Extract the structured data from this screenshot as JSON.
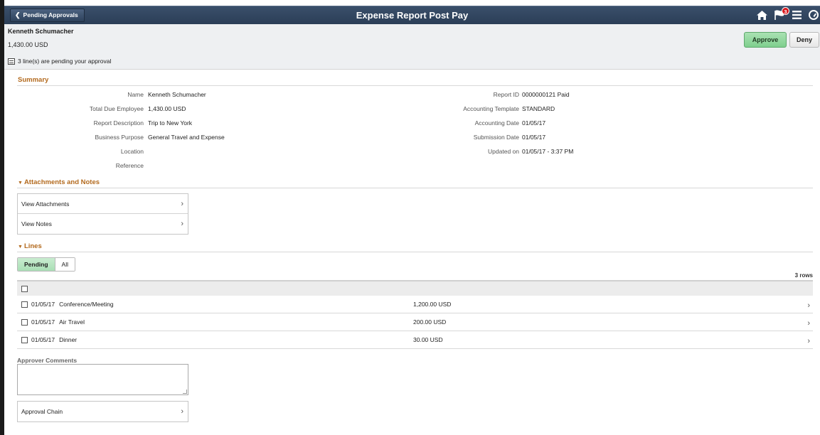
{
  "banner": {
    "back_label": "Pending Approvals",
    "title": "Expense Report Post Pay",
    "notification_count": "3",
    "icons": [
      "home-icon",
      "flag-icon",
      "menu-icon",
      "navbar-icon"
    ]
  },
  "header": {
    "employee_name": "Kenneth Schumacher",
    "amount": "1,430.00  USD",
    "pending_lines": "3 line(s) are pending your approval",
    "approve_label": "Approve",
    "deny_label": "Deny"
  },
  "summary": {
    "title": "Summary",
    "left": [
      {
        "label": "Name",
        "value": "Kenneth Schumacher"
      },
      {
        "label": "Total Due Employee",
        "value": "1,430.00  USD"
      },
      {
        "label": "Report Description",
        "value": "Trip to New York"
      },
      {
        "label": "Business Purpose",
        "value": "General Travel and Expense"
      },
      {
        "label": "Location",
        "value": ""
      },
      {
        "label": "Reference",
        "value": ""
      }
    ],
    "right": [
      {
        "label": "Report ID",
        "value": "0000000121   Paid"
      },
      {
        "label": "Accounting Template",
        "value": "STANDARD"
      },
      {
        "label": "Accounting Date",
        "value": "01/05/17"
      },
      {
        "label": "Submission Date",
        "value": "01/05/17"
      },
      {
        "label": "Updated on",
        "value": "01/05/17 - 3:37 PM"
      }
    ]
  },
  "attachments": {
    "title": "Attachments and Notes",
    "items": [
      "View Attachments",
      "View Notes"
    ]
  },
  "lines": {
    "title": "Lines",
    "tabs": [
      "Pending",
      "All"
    ],
    "row_count": "3 rows",
    "rows": [
      {
        "date": "01/05/17",
        "type": "Conference/Meeting",
        "amount": "1,200.00  USD"
      },
      {
        "date": "01/05/17",
        "type": "Air Travel",
        "amount": "200.00  USD"
      },
      {
        "date": "01/05/17",
        "type": "Dinner",
        "amount": "30.00  USD"
      }
    ]
  },
  "approver": {
    "comments_label": "Approver Comments",
    "comments_value": "",
    "chain_label": "Approval Chain"
  },
  "colors": {
    "banner": "#2b3e57",
    "section_title": "#b36a1e",
    "approve_button": "#7fcf8e",
    "badge": "#d8151b"
  }
}
